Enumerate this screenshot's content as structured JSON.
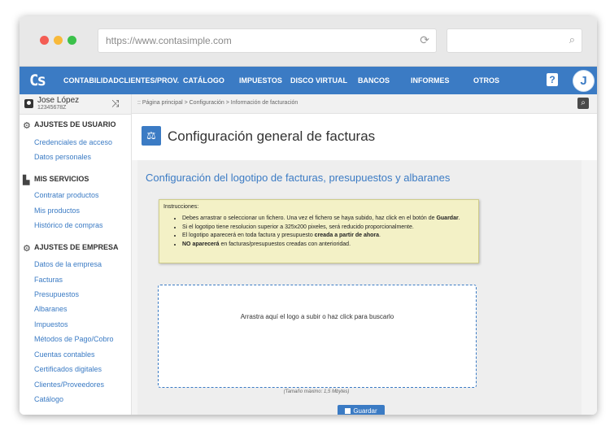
{
  "browser": {
    "url": "https://www.contasimple.com",
    "reload_icon": "reload-icon",
    "search_icon": "search-icon"
  },
  "nav": {
    "logo": "Cs",
    "items": [
      "CONTABILIDAD",
      "CLIENTES/PROV.",
      "CATÁLOGO",
      "IMPUESTOS",
      "DISCO VIRTUAL",
      "BANCOS",
      "INFORMES",
      "OTROS"
    ],
    "help": "?",
    "avatar_letter": "J"
  },
  "sidebar": {
    "user_name": "Jose López",
    "user_id": "12345678Z",
    "sections": [
      {
        "title": "AJUSTES DE USUARIO",
        "icon": "gear-icon",
        "items": [
          "Credenciales de acceso",
          "Datos personales"
        ]
      },
      {
        "title": "MIS SERVICIOS",
        "icon": "bag-icon",
        "items": [
          "Contratar productos",
          "Mis productos",
          "Histórico de compras"
        ]
      },
      {
        "title": "AJUSTES DE EMPRESA",
        "icon": "gear-icon",
        "items": [
          "Datos de la empresa",
          "Facturas",
          "Presupuestos",
          "Albaranes",
          "Impuestos",
          "Métodos de Pago/Cobro",
          "Cuentas contables",
          "Certificados digitales",
          "Clientes/Proveedores",
          "Catálogo"
        ]
      }
    ]
  },
  "breadcrumb": ":: Página principal > Configuración > Información de facturación",
  "page": {
    "title": "Configuración general de facturas",
    "panel_title": "Configuración del logotipo de facturas, presupuestos y albaranes",
    "instructions_title": "Instrucciones:",
    "instructions": [
      {
        "pre": "Debes arrastrar o seleccionar un fichero. Una vez el fichero se haya subido, haz click en el botón de ",
        "bold": "Guardar",
        "post": "."
      },
      {
        "pre": "Si el logotipo tiene resolucion superior a 325x200 pixeles, será reducido proporcionalmente.",
        "bold": "",
        "post": ""
      },
      {
        "pre": "El logotipo aparecerá en toda factura y presupuesto ",
        "bold": "creada a partir de ahora",
        "post": "."
      },
      {
        "pre": "",
        "bold": "NO aparecerá",
        "post": " en facturas/presupuestos creadas con anterioridad."
      }
    ],
    "dropzone_text": "Arrastra aquí el logo a subir o haz click para buscarlo",
    "max_size": "(Tamaño máximo: 1,5 Mbytes)",
    "save_label": "Guardar"
  }
}
